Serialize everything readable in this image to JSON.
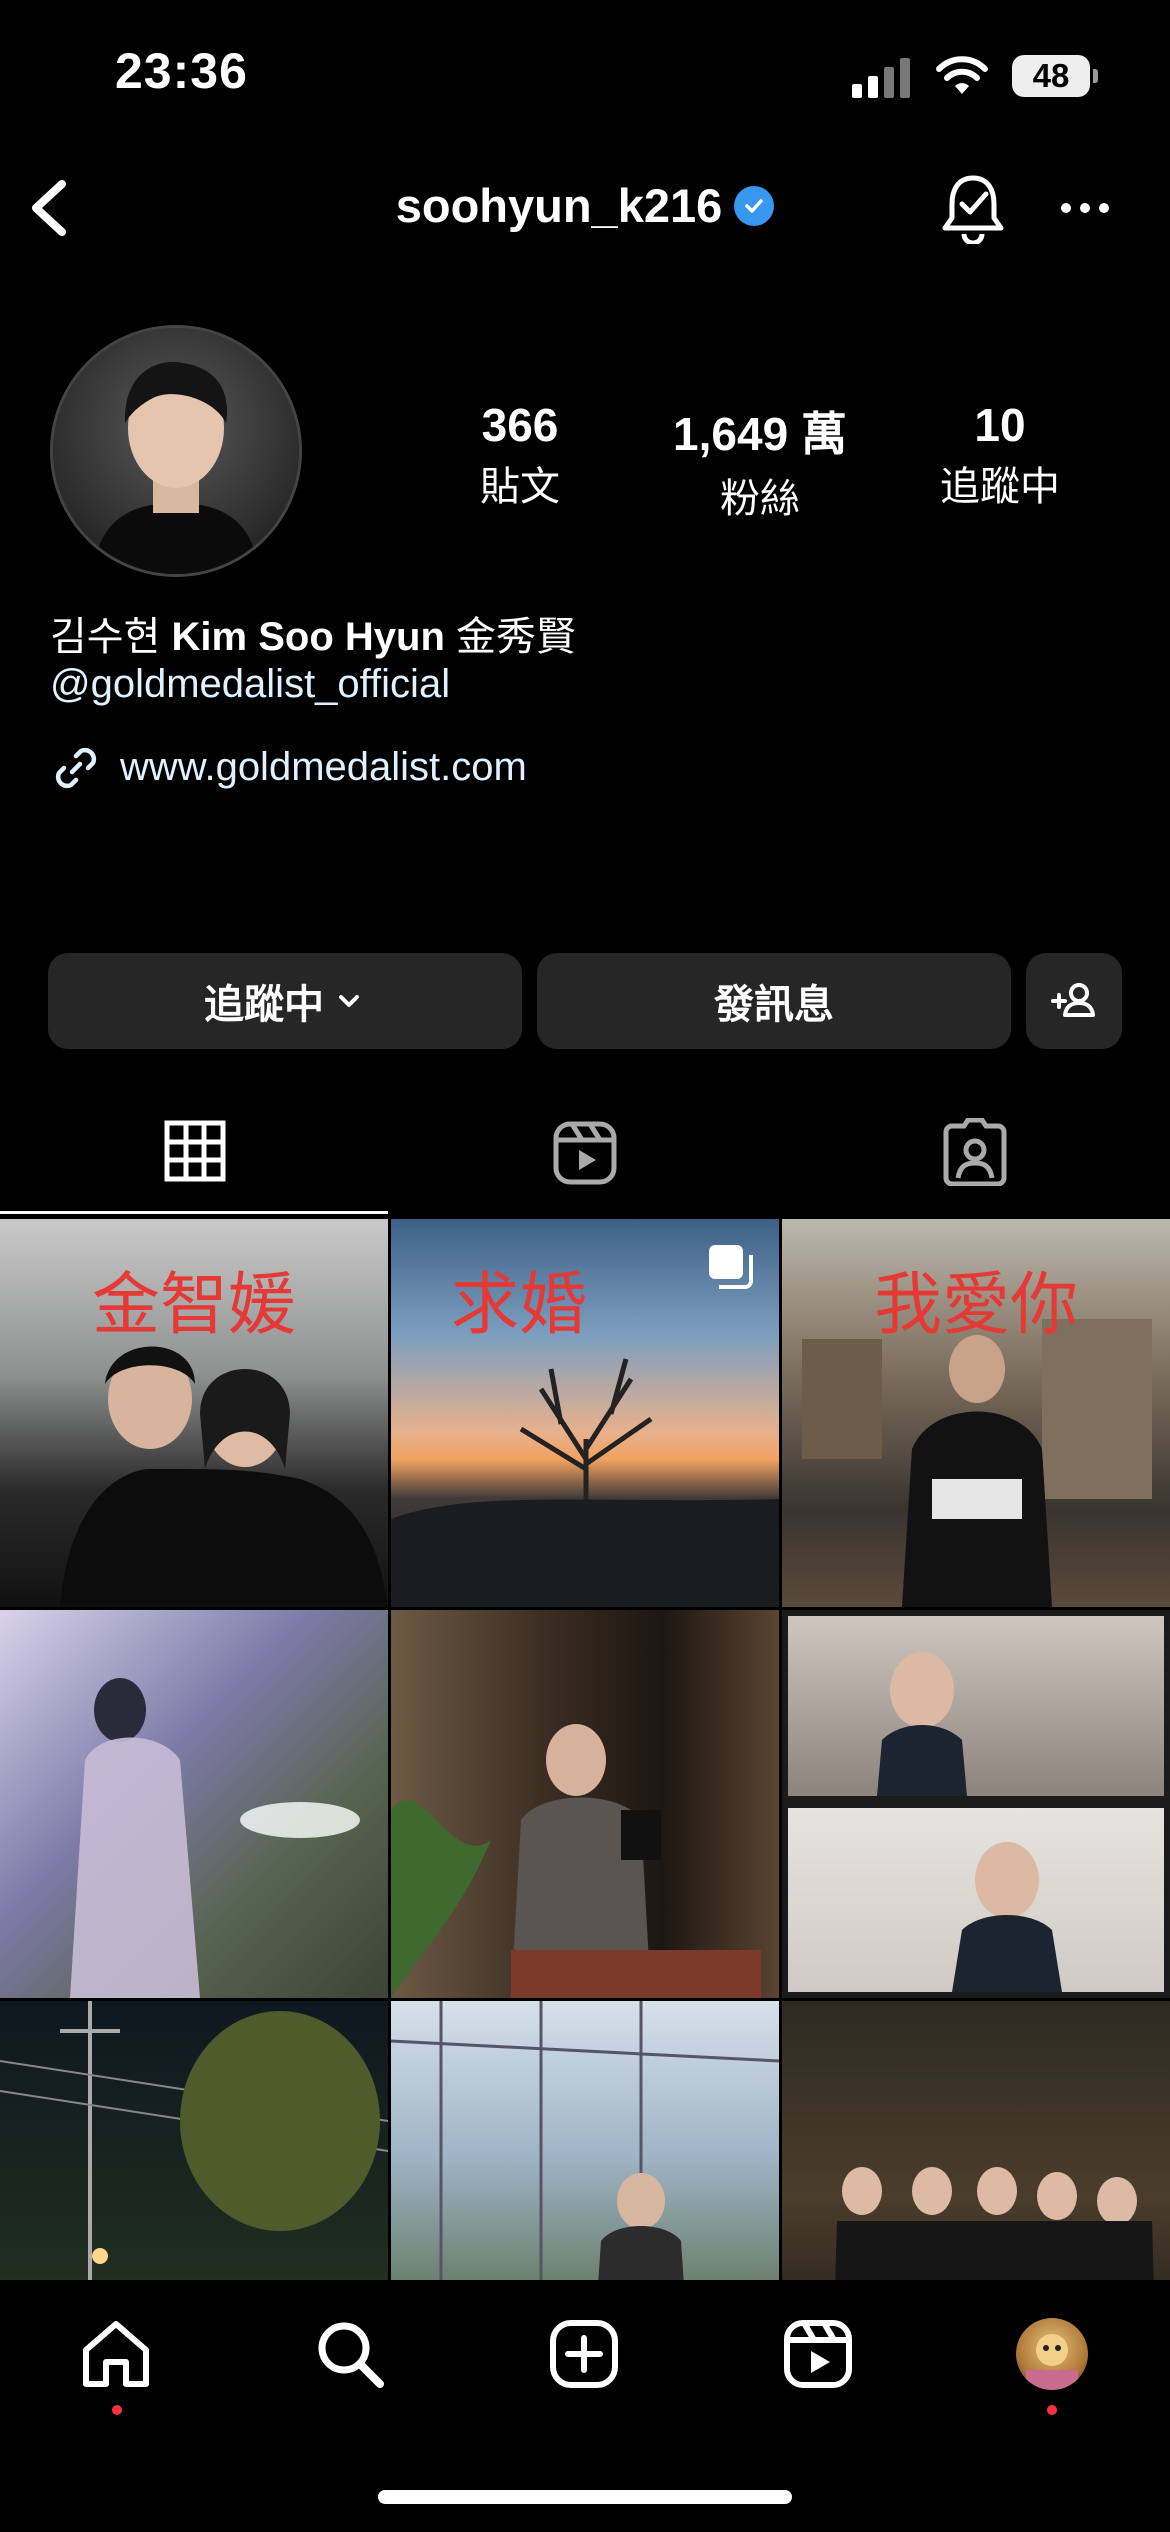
{
  "status_bar": {
    "time": "23:36",
    "battery": "48"
  },
  "header": {
    "username": "soohyun_k216"
  },
  "stats": [
    {
      "value": "366",
      "label": "貼文"
    },
    {
      "value": "1,649 萬",
      "label": "粉絲"
    },
    {
      "value": "10",
      "label": "追蹤中"
    }
  ],
  "bio": {
    "name_korean": "김수현",
    "name_latin": "Kim Soo Hyun",
    "name_chinese": "金秀賢",
    "mention": "@goldmedalist_official",
    "link": "www.goldmedalist.com"
  },
  "buttons": {
    "following": "追蹤中",
    "message": "發訊息"
  },
  "grid_captions": [
    "金智媛",
    "求婚",
    "我愛你"
  ],
  "colors": {
    "background": "#000000",
    "button": "#262626",
    "verified": "#3897f0",
    "notification_dot": "#ff3040"
  }
}
